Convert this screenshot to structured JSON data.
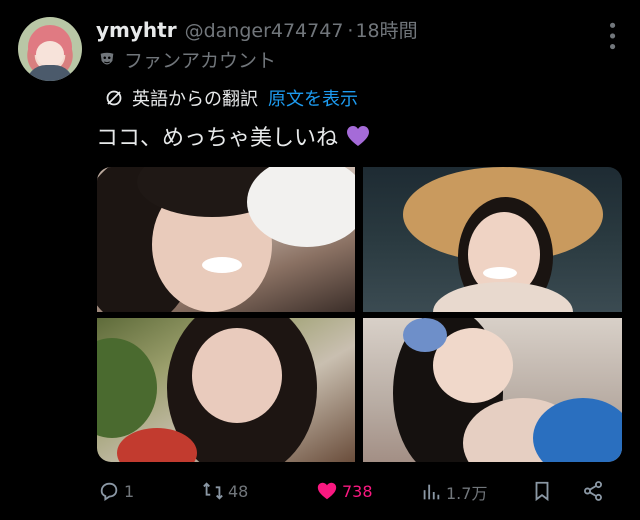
{
  "tweet": {
    "display_name": "ymyhtr",
    "handle": "@danger474747",
    "separator": "·",
    "time": "18時間",
    "account_label": "ファンアカウント",
    "translation_label": "英語からの翻訳",
    "show_original_link": "原文を表示",
    "text": "ココ、めっちゃ美しいね"
  },
  "media": {
    "images": [
      {
        "icon": "photo-1"
      },
      {
        "icon": "photo-2"
      },
      {
        "icon": "photo-3"
      },
      {
        "icon": "photo-4"
      }
    ]
  },
  "actions": {
    "reply_count": "1",
    "retweet_count": "48",
    "like_count": "738",
    "view_count": "1.7万"
  },
  "colors": {
    "background": "#000000",
    "text": "#e7e9ea",
    "muted": "#71767b",
    "link": "#1d9bf0",
    "like": "#f91880",
    "purple_heart": "#a56bd8"
  }
}
